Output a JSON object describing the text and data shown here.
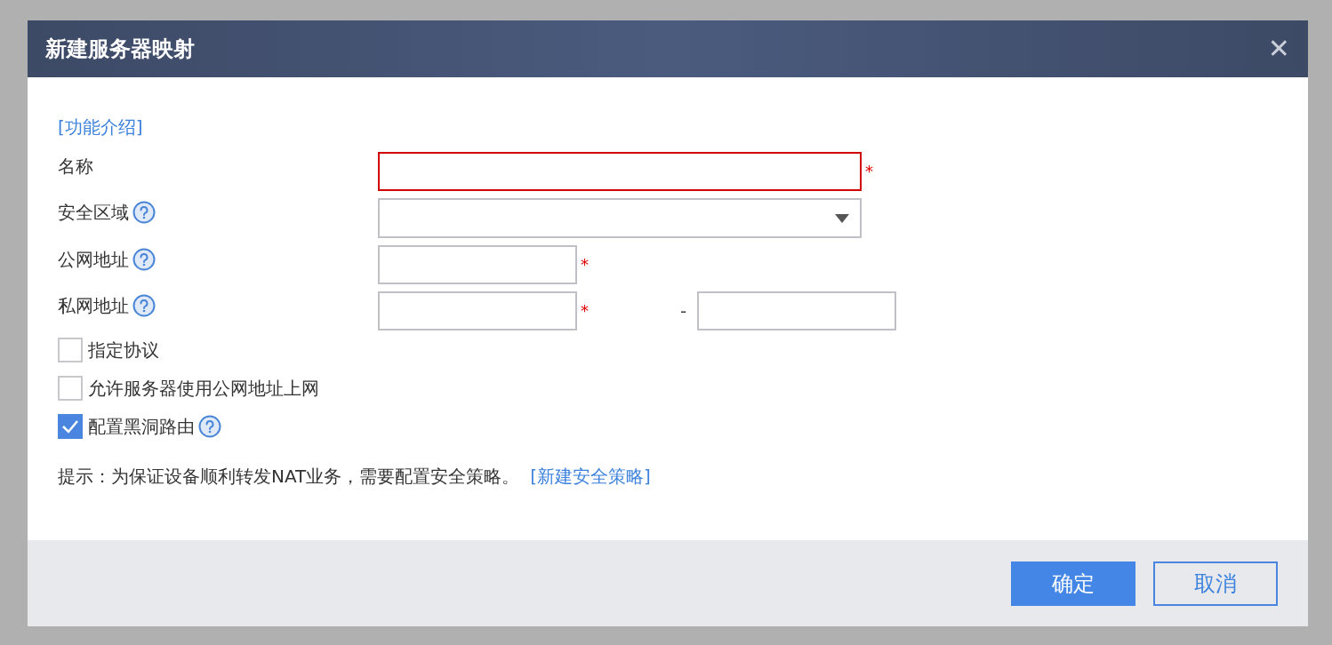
{
  "dialog": {
    "title": "新建服务器映射",
    "close": "✕"
  },
  "intro_link": "[功能介绍]",
  "fields": [
    {
      "kind": "wide",
      "label": "名称",
      "help": false,
      "error": true,
      "required_mark": "*"
    },
    {
      "kind": "select",
      "label": "安全区域",
      "help": true,
      "error": false
    },
    {
      "kind": "short",
      "label": "公网地址",
      "help": true,
      "error": false,
      "required_mark": "*"
    },
    {
      "kind": "range",
      "label": "私网地址",
      "help": true,
      "error": false,
      "required_mark": "*",
      "separator": "-"
    }
  ],
  "checkboxes": [
    {
      "label": "指定协议",
      "checked": false,
      "help": false
    },
    {
      "label": "允许服务器使用公网地址上网",
      "checked": false,
      "help": false
    },
    {
      "label": "配置黑洞路由",
      "checked": true,
      "help": true
    }
  ],
  "hint": {
    "text": "提示：为保证设备顺利转发NAT业务，需要配置安全策略。",
    "link": "[新建安全策略]"
  },
  "buttons": [
    {
      "label": "确定",
      "kind": "primary"
    },
    {
      "label": "取消",
      "kind": "secondary"
    }
  ]
}
